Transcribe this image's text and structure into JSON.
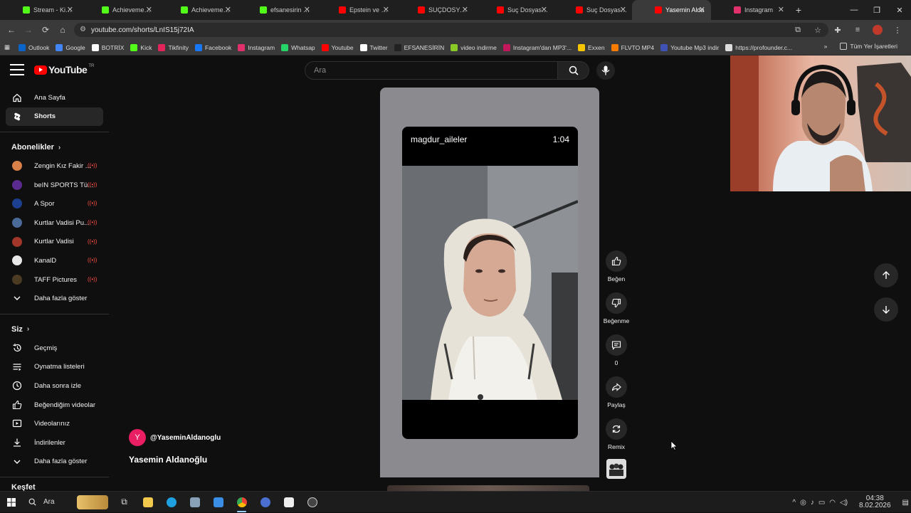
{
  "browser": {
    "tabs": [
      {
        "title": "Stream - Kick Das",
        "color": "#53fc18"
      },
      {
        "title": "Achievements - K",
        "color": "#53fc18"
      },
      {
        "title": "Achievements - K",
        "color": "#53fc18"
      },
      {
        "title": "efsanesirin Stream",
        "color": "#53fc18"
      },
      {
        "title": "Epstein ve Çiftl İn",
        "color": "#ff0000"
      },
      {
        "title": "SUÇDOSYASI - Yo",
        "color": "#ff0000"
      },
      {
        "title": "Suç Dosyası | Atal",
        "color": "#ff0000"
      },
      {
        "title": "Suç Dosyası | Dila",
        "color": "#ff0000"
      },
      {
        "title": "Yasemin Alda",
        "color": "#ff0000",
        "active": true
      },
      {
        "title": "Instagram",
        "color": "#e1306c"
      }
    ],
    "url": "youtube.com/shorts/LnIS15j72IA",
    "bookmarks": [
      {
        "label": "Outlook",
        "color": "#0a64c9"
      },
      {
        "label": "Google",
        "color": "#4285f4"
      },
      {
        "label": "BOTRİX",
        "color": "#ffffff"
      },
      {
        "label": "Kick",
        "color": "#53fc18"
      },
      {
        "label": "Tikfinity",
        "color": "#e3245a"
      },
      {
        "label": "Facebook",
        "color": "#1877f2"
      },
      {
        "label": "Instagram",
        "color": "#e1306c"
      },
      {
        "label": "Whatsap",
        "color": "#25d366"
      },
      {
        "label": "Youtube",
        "color": "#ff0000"
      },
      {
        "label": "Twitter",
        "color": "#ffffff"
      },
      {
        "label": "EFSANESİRİN",
        "color": "#222222"
      },
      {
        "label": "video indirme",
        "color": "#8ac926"
      },
      {
        "label": "Instagram'dan MP3'...",
        "color": "#c2185b"
      },
      {
        "label": "Exxen",
        "color": "#f7c600"
      },
      {
        "label": "FLVTO MP4",
        "color": "#f57c00"
      },
      {
        "label": "Youtube Mp3 indir",
        "color": "#3f51b5"
      },
      {
        "label": "https://profounder.c...",
        "color": "#dddddd"
      }
    ],
    "all_bookmarks": "Tüm Yer İşaretleri"
  },
  "youtube": {
    "logo": "YouTube",
    "logo_suffix": "TR",
    "search_placeholder": "Ara",
    "sidebar": {
      "main": [
        {
          "label": "Ana Sayfa",
          "icon": "home-icon"
        },
        {
          "label": "Shorts",
          "icon": "shorts-icon",
          "active": true
        }
      ],
      "subscriptions_header": "Abonelikler",
      "subscriptions": [
        {
          "label": "Zengin Kız Fakir ...",
          "color": "#d9804a"
        },
        {
          "label": "beIN SPORTS Tü...",
          "color": "#5b2b8f"
        },
        {
          "label": "A Spor",
          "color": "#1c3f8f"
        },
        {
          "label": "Kurtlar Vadisi Pu...",
          "color": "#4a6a9a"
        },
        {
          "label": "Kurtlar Vadisi",
          "color": "#a1372a"
        },
        {
          "label": "KanalD",
          "color": "#e8e8e8"
        },
        {
          "label": "TAFF Pictures",
          "color": "#4b3b22"
        }
      ],
      "show_more": "Daha fazla göster",
      "you_header": "Siz",
      "you_items": [
        {
          "label": "Geçmiş",
          "icon": "history-icon"
        },
        {
          "label": "Oynatma listeleri",
          "icon": "playlists-icon"
        },
        {
          "label": "Daha sonra izle",
          "icon": "watch-later-icon"
        },
        {
          "label": "Beğendiğim videolar",
          "icon": "liked-icon"
        },
        {
          "label": "Videolarınız",
          "icon": "your-videos-icon"
        },
        {
          "label": "İndirilenler",
          "icon": "downloads-icon"
        }
      ],
      "show_more_2": "Daha fazla göster",
      "explore_header": "Keşfet"
    },
    "short": {
      "overlay_user": "magdur_aileler",
      "overlay_time": "1:04",
      "channel_initial": "Y",
      "channel_handle": "@YaseminAldanoglu",
      "title": "Yasemin Aldanoğlu"
    },
    "actions": {
      "like": "Beğen",
      "dislike": "Beğenme",
      "comments": "0",
      "share": "Paylaş",
      "remix": "Remix"
    }
  },
  "taskbar": {
    "search": "Ara",
    "time": "04:38",
    "date": "8.02.2026"
  }
}
